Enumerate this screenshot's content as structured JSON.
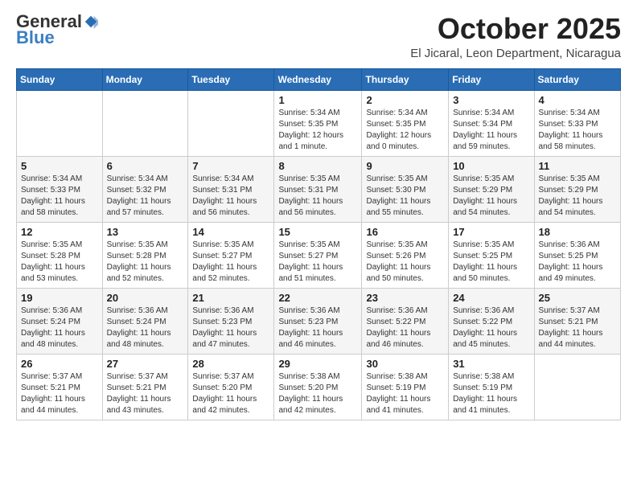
{
  "logo": {
    "general": "General",
    "blue": "Blue"
  },
  "header": {
    "month": "October 2025",
    "location": "El Jicaral, Leon Department, Nicaragua"
  },
  "weekdays": [
    "Sunday",
    "Monday",
    "Tuesday",
    "Wednesday",
    "Thursday",
    "Friday",
    "Saturday"
  ],
  "weeks": [
    [
      {
        "day": "",
        "info": ""
      },
      {
        "day": "",
        "info": ""
      },
      {
        "day": "",
        "info": ""
      },
      {
        "day": "1",
        "info": "Sunrise: 5:34 AM\nSunset: 5:35 PM\nDaylight: 12 hours\nand 1 minute."
      },
      {
        "day": "2",
        "info": "Sunrise: 5:34 AM\nSunset: 5:35 PM\nDaylight: 12 hours\nand 0 minutes."
      },
      {
        "day": "3",
        "info": "Sunrise: 5:34 AM\nSunset: 5:34 PM\nDaylight: 11 hours\nand 59 minutes."
      },
      {
        "day": "4",
        "info": "Sunrise: 5:34 AM\nSunset: 5:33 PM\nDaylight: 11 hours\nand 58 minutes."
      }
    ],
    [
      {
        "day": "5",
        "info": "Sunrise: 5:34 AM\nSunset: 5:33 PM\nDaylight: 11 hours\nand 58 minutes."
      },
      {
        "day": "6",
        "info": "Sunrise: 5:34 AM\nSunset: 5:32 PM\nDaylight: 11 hours\nand 57 minutes."
      },
      {
        "day": "7",
        "info": "Sunrise: 5:34 AM\nSunset: 5:31 PM\nDaylight: 11 hours\nand 56 minutes."
      },
      {
        "day": "8",
        "info": "Sunrise: 5:35 AM\nSunset: 5:31 PM\nDaylight: 11 hours\nand 56 minutes."
      },
      {
        "day": "9",
        "info": "Sunrise: 5:35 AM\nSunset: 5:30 PM\nDaylight: 11 hours\nand 55 minutes."
      },
      {
        "day": "10",
        "info": "Sunrise: 5:35 AM\nSunset: 5:29 PM\nDaylight: 11 hours\nand 54 minutes."
      },
      {
        "day": "11",
        "info": "Sunrise: 5:35 AM\nSunset: 5:29 PM\nDaylight: 11 hours\nand 54 minutes."
      }
    ],
    [
      {
        "day": "12",
        "info": "Sunrise: 5:35 AM\nSunset: 5:28 PM\nDaylight: 11 hours\nand 53 minutes."
      },
      {
        "day": "13",
        "info": "Sunrise: 5:35 AM\nSunset: 5:28 PM\nDaylight: 11 hours\nand 52 minutes."
      },
      {
        "day": "14",
        "info": "Sunrise: 5:35 AM\nSunset: 5:27 PM\nDaylight: 11 hours\nand 52 minutes."
      },
      {
        "day": "15",
        "info": "Sunrise: 5:35 AM\nSunset: 5:27 PM\nDaylight: 11 hours\nand 51 minutes."
      },
      {
        "day": "16",
        "info": "Sunrise: 5:35 AM\nSunset: 5:26 PM\nDaylight: 11 hours\nand 50 minutes."
      },
      {
        "day": "17",
        "info": "Sunrise: 5:35 AM\nSunset: 5:25 PM\nDaylight: 11 hours\nand 50 minutes."
      },
      {
        "day": "18",
        "info": "Sunrise: 5:36 AM\nSunset: 5:25 PM\nDaylight: 11 hours\nand 49 minutes."
      }
    ],
    [
      {
        "day": "19",
        "info": "Sunrise: 5:36 AM\nSunset: 5:24 PM\nDaylight: 11 hours\nand 48 minutes."
      },
      {
        "day": "20",
        "info": "Sunrise: 5:36 AM\nSunset: 5:24 PM\nDaylight: 11 hours\nand 48 minutes."
      },
      {
        "day": "21",
        "info": "Sunrise: 5:36 AM\nSunset: 5:23 PM\nDaylight: 11 hours\nand 47 minutes."
      },
      {
        "day": "22",
        "info": "Sunrise: 5:36 AM\nSunset: 5:23 PM\nDaylight: 11 hours\nand 46 minutes."
      },
      {
        "day": "23",
        "info": "Sunrise: 5:36 AM\nSunset: 5:22 PM\nDaylight: 11 hours\nand 46 minutes."
      },
      {
        "day": "24",
        "info": "Sunrise: 5:36 AM\nSunset: 5:22 PM\nDaylight: 11 hours\nand 45 minutes."
      },
      {
        "day": "25",
        "info": "Sunrise: 5:37 AM\nSunset: 5:21 PM\nDaylight: 11 hours\nand 44 minutes."
      }
    ],
    [
      {
        "day": "26",
        "info": "Sunrise: 5:37 AM\nSunset: 5:21 PM\nDaylight: 11 hours\nand 44 minutes."
      },
      {
        "day": "27",
        "info": "Sunrise: 5:37 AM\nSunset: 5:21 PM\nDaylight: 11 hours\nand 43 minutes."
      },
      {
        "day": "28",
        "info": "Sunrise: 5:37 AM\nSunset: 5:20 PM\nDaylight: 11 hours\nand 42 minutes."
      },
      {
        "day": "29",
        "info": "Sunrise: 5:38 AM\nSunset: 5:20 PM\nDaylight: 11 hours\nand 42 minutes."
      },
      {
        "day": "30",
        "info": "Sunrise: 5:38 AM\nSunset: 5:19 PM\nDaylight: 11 hours\nand 41 minutes."
      },
      {
        "day": "31",
        "info": "Sunrise: 5:38 AM\nSunset: 5:19 PM\nDaylight: 11 hours\nand 41 minutes."
      },
      {
        "day": "",
        "info": ""
      }
    ]
  ]
}
